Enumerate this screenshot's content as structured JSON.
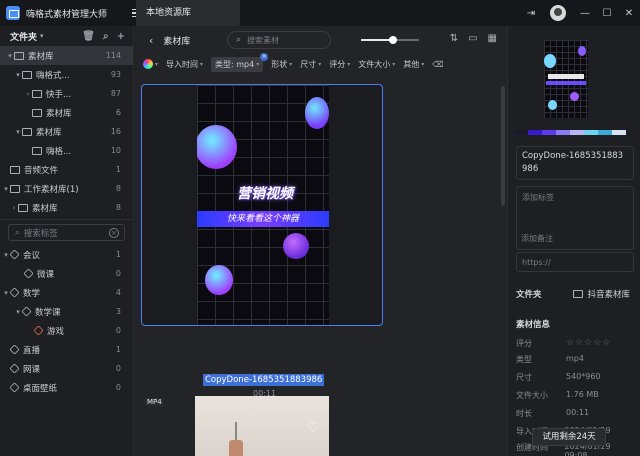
{
  "app": {
    "title": "嗨格式素材管理大师",
    "tab": "本地资源库",
    "icons": [
      "app-logo",
      "hamburger-menu-icon",
      "sidebar-toggle-icon",
      "avatar",
      "minimize-icon",
      "maximize-icon",
      "close-icon"
    ]
  },
  "sidebar": {
    "header": "文件夹",
    "items": [
      {
        "label": "素材库",
        "count": "114"
      },
      {
        "label": "嗨格式...",
        "count": "93"
      },
      {
        "label": "快手...",
        "count": "87"
      },
      {
        "label": "素材库",
        "count": "6"
      },
      {
        "label": "素材库",
        "count": "16"
      },
      {
        "label": "嗨格...",
        "count": "10"
      },
      {
        "label": "音频文件",
        "count": "1"
      },
      {
        "label": "工作素材库(1)",
        "count": "8"
      },
      {
        "label": "素材库",
        "count": "8"
      }
    ],
    "tag_search_placeholder": "搜索标签",
    "tags": [
      {
        "label": "会议",
        "count": "1"
      },
      {
        "label": "微课",
        "count": "0"
      },
      {
        "label": "数学",
        "count": "4"
      },
      {
        "label": "数学课",
        "count": "3"
      },
      {
        "label": "游戏",
        "count": "0"
      },
      {
        "label": "直播",
        "count": "1"
      },
      {
        "label": "网课",
        "count": "0"
      },
      {
        "label": "桌面壁纸",
        "count": "0"
      }
    ]
  },
  "main": {
    "breadcrumb": "素材库",
    "search_placeholder": "搜索素材",
    "zoom_level": 0.55,
    "filters": [
      "导入时间",
      "类型: mp4",
      "形状",
      "尺寸",
      "评分",
      "文件大小",
      "其他"
    ],
    "card1": {
      "video_title": "营销视频",
      "video_subtitle": "快来看看这个神器",
      "name": "CopyDone-1685351883986",
      "duration": "00:11"
    },
    "card2": {
      "badge": "MP4"
    }
  },
  "panel": {
    "palette": [
      "#1a1a2e",
      "#3a1ac8",
      "#5d3af0",
      "#8a7af5",
      "#b9b3f7",
      "#6fd3f0",
      "#3fa9d9",
      "#d8e2f5"
    ],
    "filename": "CopyDone-1685351883986",
    "tag_placeholder": "添加标签",
    "note_placeholder": "添加备注",
    "url_placeholder": "https://",
    "folder_label": "文件夹",
    "folder_value": "抖音素材库",
    "info_title": "素材信息",
    "info": [
      {
        "k": "评分",
        "v": ""
      },
      {
        "k": "类型",
        "v": "mp4"
      },
      {
        "k": "尺寸",
        "v": "540*960"
      },
      {
        "k": "文件大小",
        "v": "1.76 MB"
      },
      {
        "k": "时长",
        "v": "00:11"
      },
      {
        "k": "导入时间",
        "v": "2024/01/29 09:08"
      },
      {
        "k": "创建时间",
        "v": "2024/01/29 09:08"
      }
    ],
    "trial": "试用剩余24天"
  }
}
